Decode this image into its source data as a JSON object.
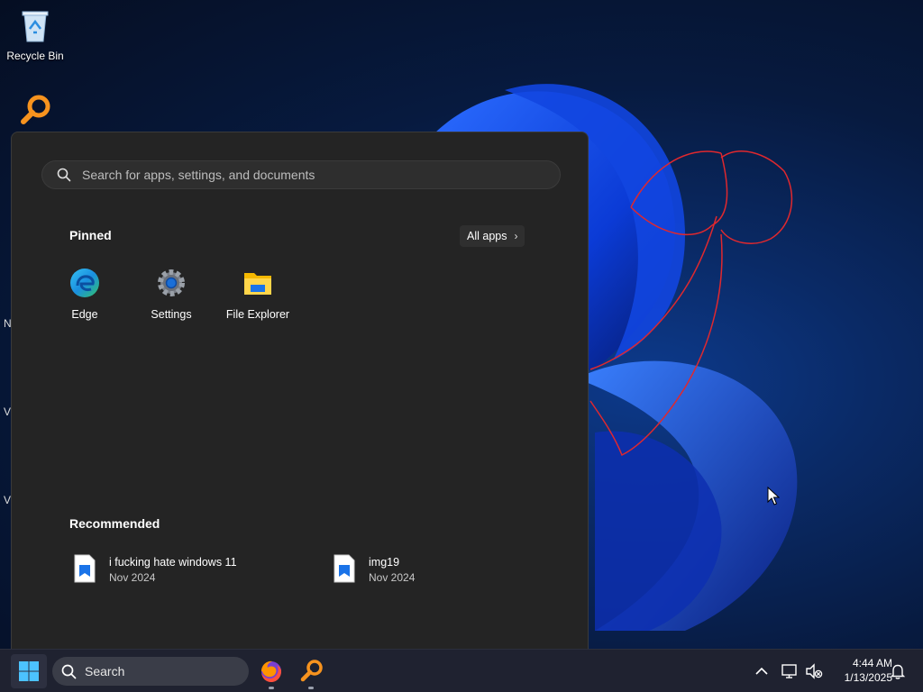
{
  "desktop": {
    "recycle_bin_label": "Recycle Bin",
    "stubs": [
      "N",
      "V",
      "V"
    ]
  },
  "start_menu": {
    "search": {
      "placeholder": "Search for apps, settings, and documents"
    },
    "pinned": {
      "title": "Pinned",
      "all_apps_label": "All apps",
      "apps": [
        {
          "label": "Edge",
          "icon": "edge-icon"
        },
        {
          "label": "Settings",
          "icon": "gear-icon"
        },
        {
          "label": "File Explorer",
          "icon": "folder-icon"
        }
      ]
    },
    "recommended": {
      "title": "Recommended",
      "items": [
        {
          "name": "i fucking hate windows 11",
          "date": "Nov 2024",
          "icon": "image-file-icon"
        },
        {
          "name": "img19",
          "date": "Nov 2024",
          "icon": "image-file-icon"
        }
      ]
    }
  },
  "taskbar": {
    "search_label": "Search",
    "pinned_apps": [
      "firefox-icon",
      "search-tool-icon"
    ],
    "tray": [
      "chevron-up-icon",
      "network-icon",
      "volume-muted-icon"
    ],
    "clock": {
      "time": "4:44 AM",
      "date": "1/13/2025"
    },
    "notification_icon": "bell-icon"
  },
  "colors": {
    "menu_bg": "#242424",
    "taskbar_bg": "#1f2230",
    "accent_blue": "#1a73e8",
    "drawing_red": "#e0282e"
  }
}
